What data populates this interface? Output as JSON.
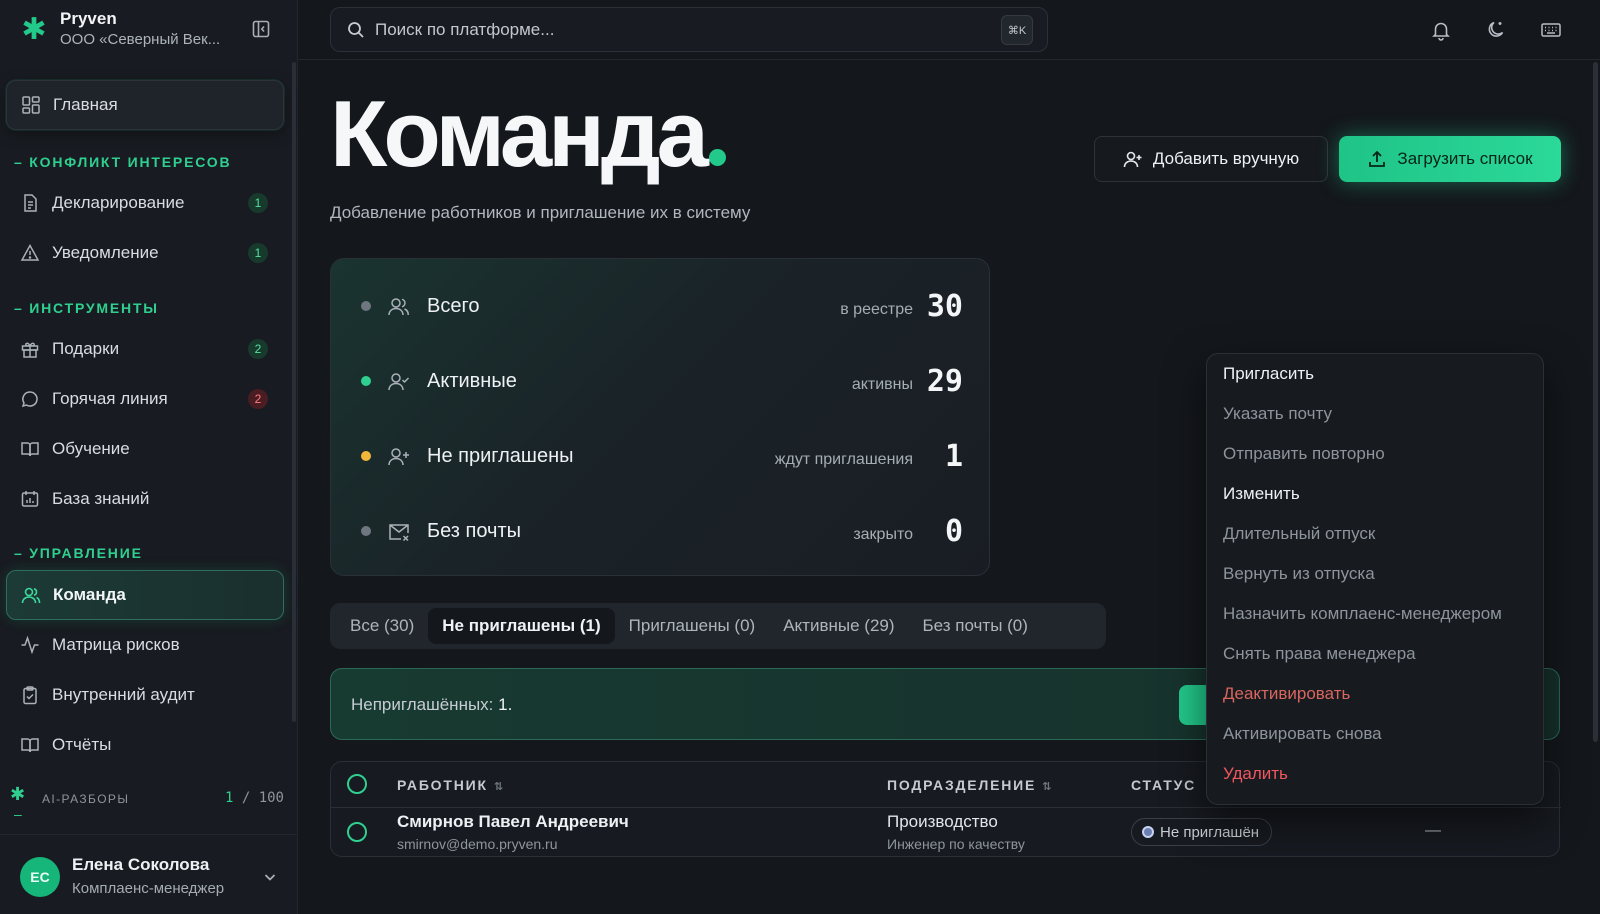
{
  "brand": {
    "name": "Pryven",
    "org": "ООО «Северный Век..."
  },
  "search": {
    "placeholder": "Поиск по платформе...",
    "shortcut": "⌘K"
  },
  "sidebar": {
    "home": "Главная",
    "sections": [
      {
        "label": "КОНФЛИКТ ИНТЕРЕСОВ"
      },
      {
        "label": "ИНСТРУМЕНТЫ"
      },
      {
        "label": "УПРАВЛЕНИЕ"
      }
    ],
    "items": {
      "declaration": {
        "label": "Декларирование",
        "badge": "1"
      },
      "notification": {
        "label": "Уведомление",
        "badge": "1"
      },
      "gifts": {
        "label": "Подарки",
        "badge": "2"
      },
      "hotline": {
        "label": "Горячая линия",
        "badge": "2"
      },
      "training": {
        "label": "Обучение"
      },
      "knowledge": {
        "label": "База знаний"
      },
      "team": {
        "label": "Команда"
      },
      "risk": {
        "label": "Матрица рисков"
      },
      "audit": {
        "label": "Внутренний аудит"
      },
      "reports": {
        "label": "Отчёты"
      }
    },
    "ai": {
      "label": "AI-РАЗБОРЫ",
      "used": "1",
      "limit": "/ 100"
    },
    "user": {
      "initials": "ЕС",
      "name": "Елена Соколова",
      "role": "Комплаенс-менеджер"
    }
  },
  "page": {
    "title": "Команда",
    "subtitle": "Добавление работников и приглашение их в систему",
    "add_manual": "Добавить вручную",
    "upload": "Загрузить список"
  },
  "stats": [
    {
      "label": "Всего",
      "hint": "в реестре",
      "value": "30",
      "color": "#6f7680"
    },
    {
      "label": "Активные",
      "hint": "активны",
      "value": "29",
      "color": "#2fd08f"
    },
    {
      "label": "Не приглашены",
      "hint": "ждут приглашения",
      "value": "1",
      "color": "#f2b63a"
    },
    {
      "label": "Без почты",
      "hint": "закрыто",
      "value": "0",
      "color": "#6f7680"
    }
  ],
  "tabs": [
    "Все (30)",
    "Не приглашены (1)",
    "Приглашены (0)",
    "Активные (29)",
    "Без почты (0)"
  ],
  "notice": {
    "label": "Неприглашённых:",
    "count": "1."
  },
  "table": {
    "headers": {
      "employee": "РАБОТНИК",
      "department": "ПОДРАЗДЕЛЕНИЕ",
      "status": "СТАТУС"
    },
    "rows": [
      {
        "name": "Смирнов Павел Андреевич",
        "email": "smirnov@demo.pryven.ru",
        "department": "Производство",
        "position": "Инженер по качеству",
        "status": "Не приглашён",
        "extra": "—"
      }
    ]
  },
  "menu": [
    "Пригласить",
    "Указать почту",
    "Отправить повторно",
    "Изменить",
    "Длительный отпуск",
    "Вернуть из отпуска",
    "Назначить комплаенс-менеджером",
    "Снять права менеджера",
    "Деактивировать",
    "Активировать снова",
    "Удалить"
  ]
}
